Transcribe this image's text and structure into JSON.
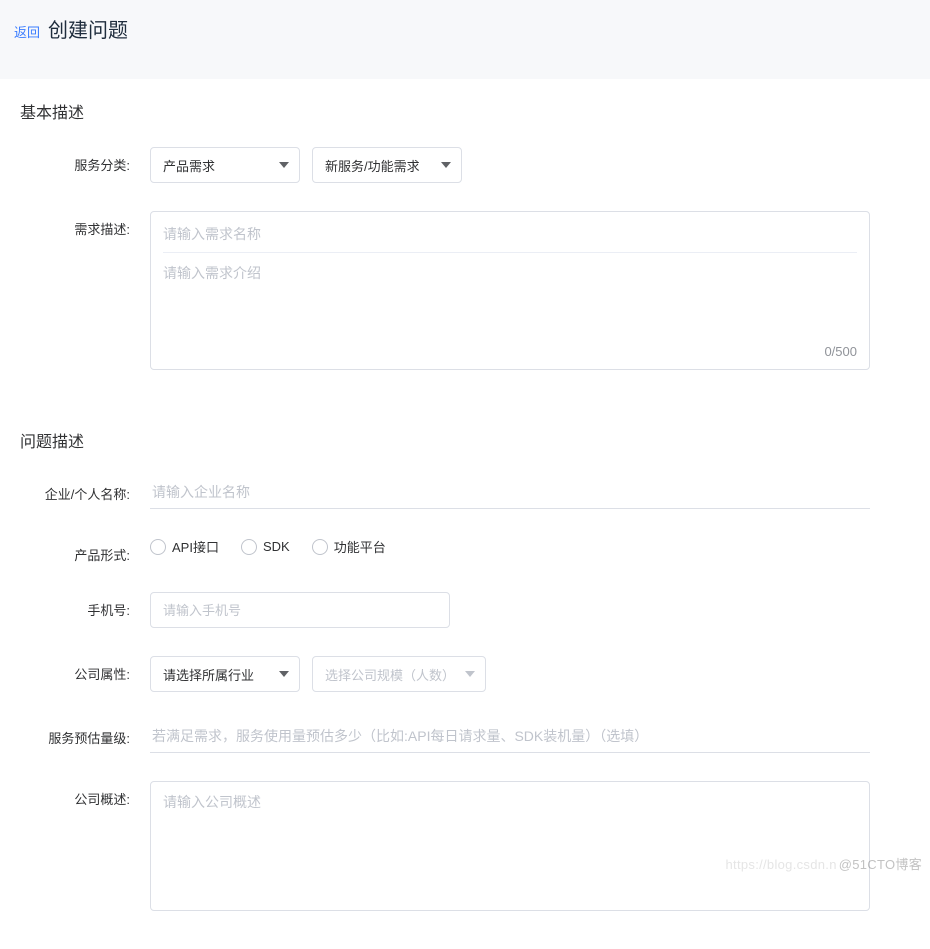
{
  "header": {
    "back_label": "返回",
    "title": "创建问题"
  },
  "section_basic": {
    "title": "基本描述",
    "service_class": {
      "label": "服务分类:",
      "select1": "产品需求",
      "select2": "新服务/功能需求"
    },
    "requirement_desc": {
      "label": "需求描述:",
      "title_placeholder": "请输入需求名称",
      "body_placeholder": "请输入需求介绍",
      "counter": "0/500"
    }
  },
  "section_issue": {
    "title": "问题描述",
    "org_name": {
      "label": "企业/个人名称:",
      "placeholder": "请输入企业名称"
    },
    "product_form": {
      "label": "产品形式:",
      "options": [
        "API接口",
        "SDK",
        "功能平台"
      ]
    },
    "phone": {
      "label": "手机号:",
      "placeholder": "请输入手机号"
    },
    "company_attr": {
      "label": "公司属性:",
      "select1": "请选择所属行业",
      "select2_placeholder": "选择公司规模（人数）"
    },
    "service_est": {
      "label": "服务预估量级:",
      "placeholder": "若满足需求，服务使用量预估多少（比如:API每日请求量、SDK装机量）（选填）"
    },
    "company_overview": {
      "label": "公司概述:",
      "placeholder": "请输入公司概述"
    }
  },
  "watermark": {
    "faded": "https://blog.csdn.n",
    "main": "@51CTO博客"
  }
}
